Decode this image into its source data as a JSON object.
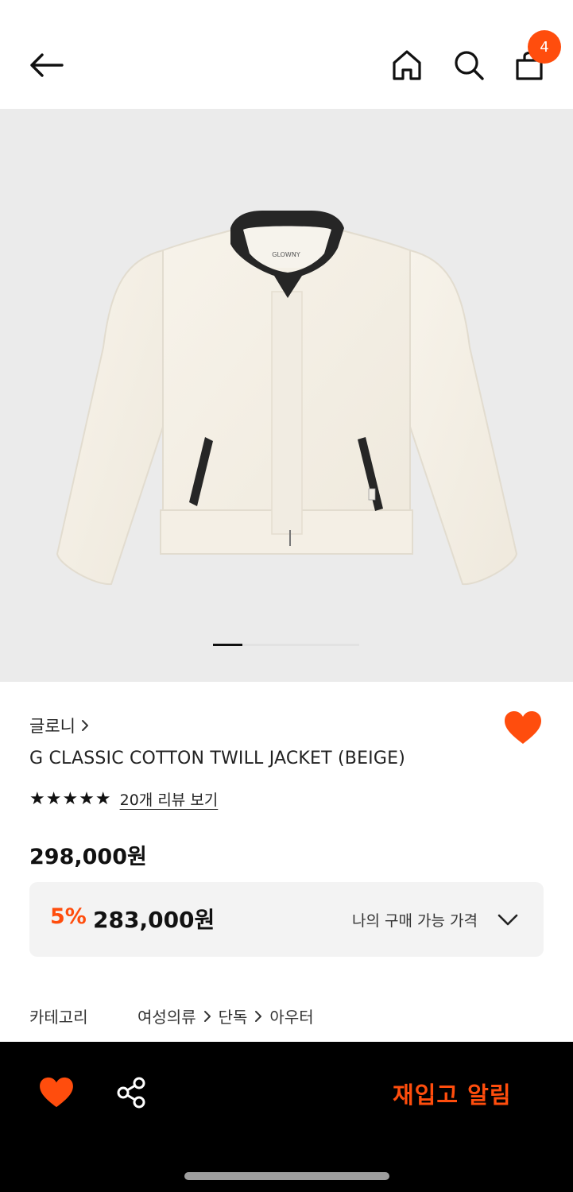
{
  "header": {
    "cart_count": "4"
  },
  "product": {
    "brand": "글로니",
    "name": "G CLASSIC COTTON TWILL JACKET (BEIGE)",
    "rating": 5,
    "stars": "★★★★★",
    "review_link": "20개 리뷰 보기",
    "price": "298,000원",
    "discount_rate": "5%",
    "sale_price": "283,000원",
    "available_price_label": "나의 구매 가능 가격",
    "image_label": "GLOWNY"
  },
  "gallery": {
    "current_index": 1,
    "total": 5
  },
  "category": {
    "label": "카테고리",
    "path": [
      "여성의류",
      "단독",
      "아우터"
    ]
  },
  "bottom_bar": {
    "restock_label": "재입고 알림"
  },
  "colors": {
    "accent": "#ff4d0d",
    "bar": "#000000",
    "gallery_bg": "#ebebeb"
  }
}
